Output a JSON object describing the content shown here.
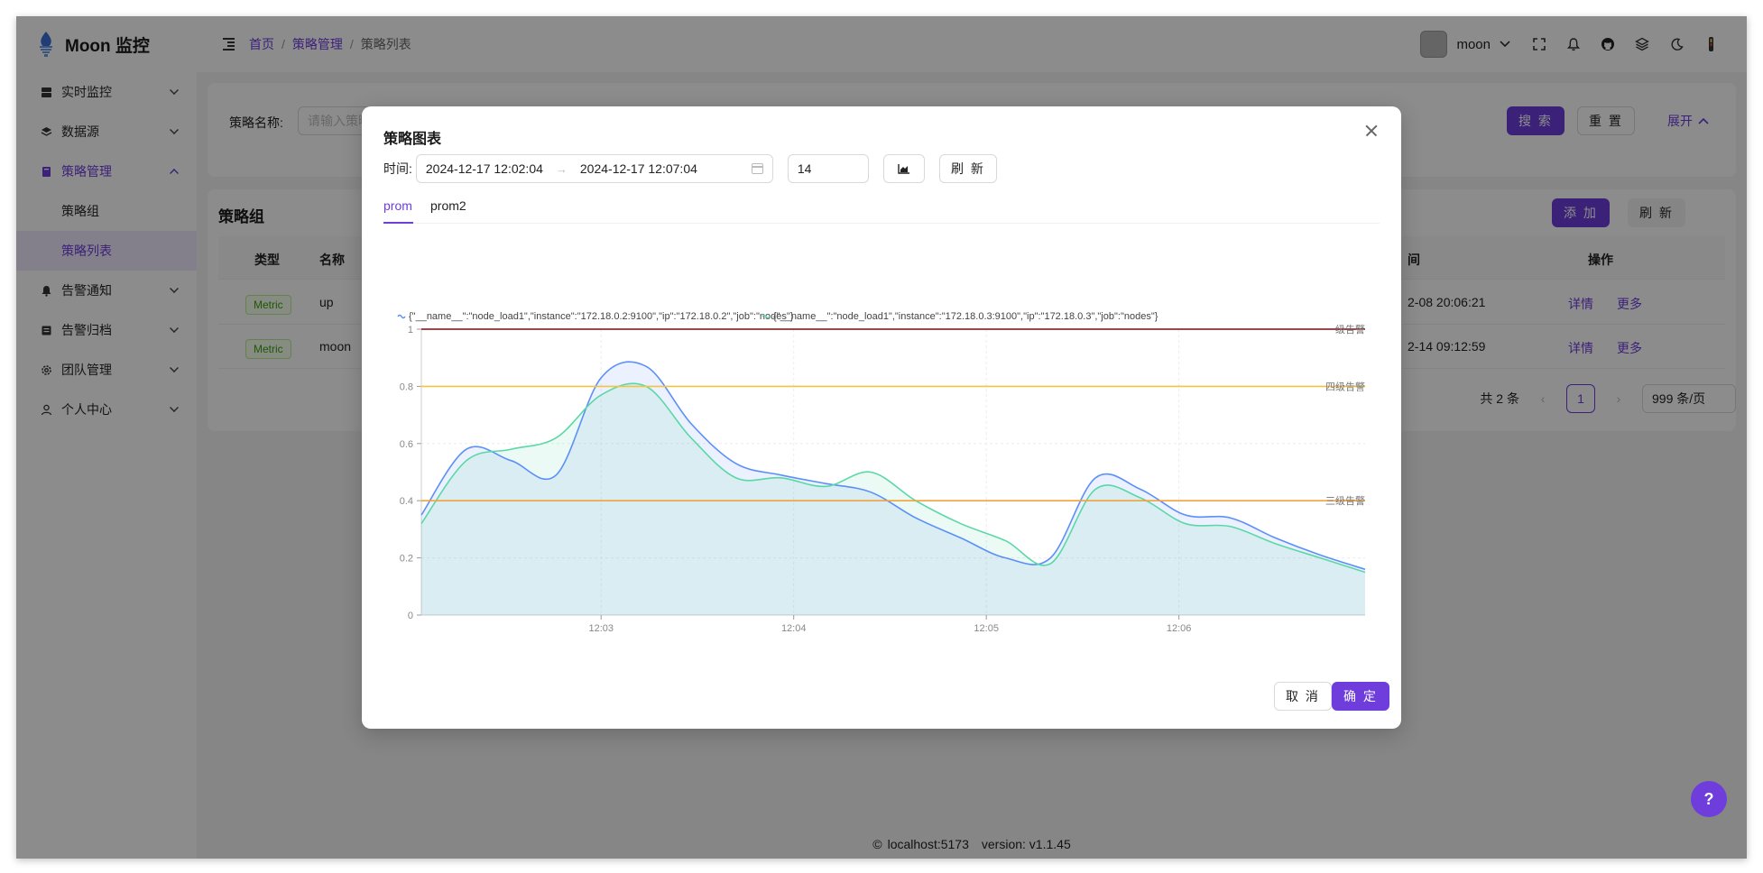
{
  "app": {
    "title": "Moon 监控",
    "colors": {
      "primary": "#6e3ddc"
    }
  },
  "sidebar": {
    "items": [
      {
        "label": "实时监控",
        "icon": "server-icon"
      },
      {
        "label": "数据源",
        "icon": "layers-icon"
      },
      {
        "label": "策略管理",
        "icon": "book-icon",
        "open": true
      },
      {
        "label": "告警通知",
        "icon": "bell-icon"
      },
      {
        "label": "告警归档",
        "icon": "archive-icon"
      },
      {
        "label": "团队管理",
        "icon": "gear-icon"
      },
      {
        "label": "个人中心",
        "icon": "user-icon"
      }
    ],
    "sub": [
      "策略组",
      "策略列表"
    ]
  },
  "header": {
    "breadcrumb": [
      "首页",
      "策略管理",
      "策略列表"
    ],
    "username": "moon"
  },
  "search": {
    "label": "策略名称:",
    "placeholder": "请输入策略",
    "search_btn": "搜 索",
    "reset_btn": "重 置",
    "expand": "展开"
  },
  "list": {
    "title": "策略组",
    "add_btn": "添 加",
    "refresh_btn": "刷 新",
    "columns": {
      "type": "类型",
      "name": "名称",
      "time_suffix": "间",
      "actions": "操作"
    },
    "rows": [
      {
        "type": "Metric",
        "name": "up",
        "time": "2-08 20:06:21",
        "detail": "详情",
        "more": "更多"
      },
      {
        "type": "Metric",
        "name": "moon",
        "time": "2-14 09:12:59",
        "detail": "详情",
        "more": "更多"
      }
    ],
    "total": "共 2 条",
    "page": "1",
    "page_size": "999 条/页"
  },
  "footer": {
    "text": "localhost:5173",
    "version": "version: v1.1.45"
  },
  "modal": {
    "title": "策略图表",
    "time_label": "时间:",
    "start": "2024-12-17 12:02:04",
    "end": "2024-12-17 12:07:04",
    "step": "14",
    "refresh_btn": "刷 新",
    "tabs": [
      "prom",
      "prom2"
    ],
    "cancel_btn": "取 消",
    "ok_btn": "确 定"
  },
  "chart_data": {
    "type": "area",
    "x": [
      "12:02:04",
      "12:02:18",
      "12:02:32",
      "12:02:46",
      "12:03:00",
      "12:03:14",
      "12:03:28",
      "12:03:42",
      "12:03:56",
      "12:04:10",
      "12:04:24",
      "12:04:38",
      "12:04:52",
      "12:05:06",
      "12:05:20",
      "12:05:34",
      "12:05:48",
      "12:06:02",
      "12:06:16",
      "12:06:30",
      "12:06:44",
      "12:06:58"
    ],
    "x_ticks": [
      "12:03",
      "12:04",
      "12:05",
      "12:06"
    ],
    "y_ticks": [
      "0",
      "0.2",
      "0.4",
      "0.6",
      "0.8",
      "1"
    ],
    "ylim": [
      0,
      1
    ],
    "grid": true,
    "legend_position": "top",
    "series": [
      {
        "name": "{\"__name__\":\"node_load1\",\"instance\":\"172.18.0.2:9100\",\"ip\":\"172.18.0.2\",\"job\":\"nodes\"}",
        "color": "#5b8ff9",
        "values": [
          0.35,
          0.58,
          0.54,
          0.49,
          0.83,
          0.87,
          0.67,
          0.53,
          0.49,
          0.46,
          0.43,
          0.34,
          0.27,
          0.2,
          0.2,
          0.48,
          0.44,
          0.35,
          0.34,
          0.27,
          0.21,
          0.16
        ]
      },
      {
        "name": "{\"__name__\":\"node_load1\",\"instance\":\"172.18.0.3:9100\",\"ip\":\"172.18.0.3\",\"job\":\"nodes\"}",
        "color": "#5ad8a6",
        "values": [
          0.32,
          0.54,
          0.58,
          0.62,
          0.77,
          0.8,
          0.62,
          0.48,
          0.48,
          0.45,
          0.5,
          0.4,
          0.32,
          0.26,
          0.18,
          0.44,
          0.41,
          0.32,
          0.31,
          0.25,
          0.2,
          0.15
        ]
      }
    ],
    "thresholds": [
      {
        "label": "级告警",
        "value": 1.0,
        "color": "#7a0c12"
      },
      {
        "label": "四级告警",
        "value": 0.8,
        "color": "#f5c242"
      },
      {
        "label": "三级告警",
        "value": 0.4,
        "color": "#f0a33d"
      }
    ]
  }
}
